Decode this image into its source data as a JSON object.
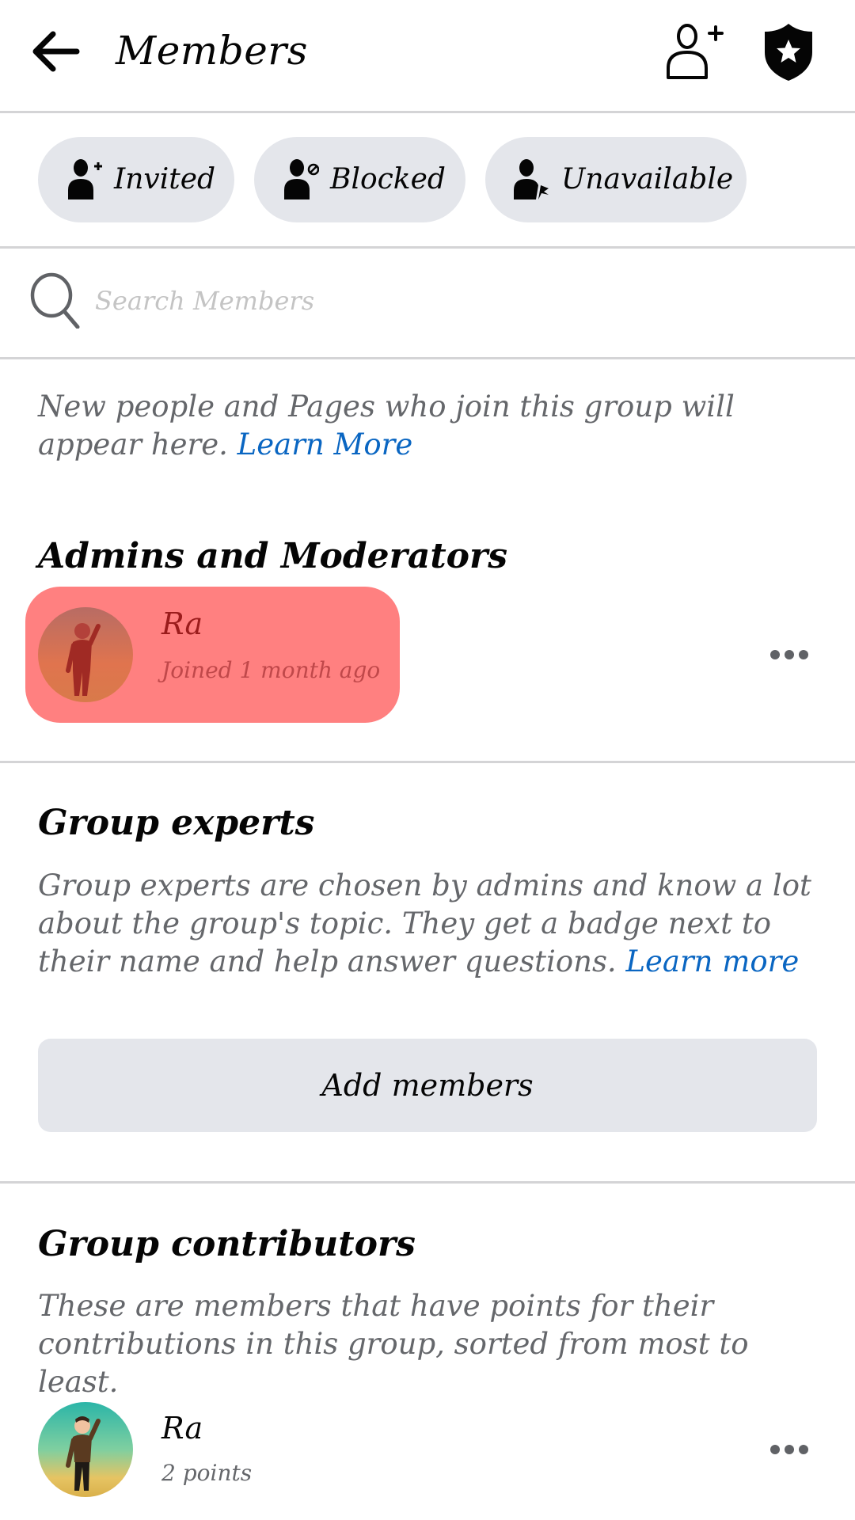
{
  "header": {
    "title": "Members",
    "back_icon": "arrow-left-icon",
    "add_member_icon": "person-add-icon",
    "admin_tools_icon": "shield-star-icon"
  },
  "filter_chips": [
    {
      "label": "Invited",
      "icon": "person-plus-icon"
    },
    {
      "label": "Blocked",
      "icon": "person-blocked-icon"
    },
    {
      "label": "Unavailable",
      "icon": "person-flag-icon"
    }
  ],
  "search": {
    "placeholder": "Search Members",
    "value": "",
    "icon": "search-icon"
  },
  "info": {
    "text": "New people and Pages who join this group will appear here.",
    "link": "Learn More"
  },
  "admins": {
    "title": "Admins and Moderators",
    "members": [
      {
        "name": "Ra",
        "subtitle": "Joined 1 month ago",
        "highlighted": true
      }
    ]
  },
  "experts": {
    "title": "Group experts",
    "text": "Group experts are chosen by admins and know a lot about the group's topic. They get a badge next to their name and help answer questions.",
    "link": "Learn more",
    "button_label": "Add members"
  },
  "contributors": {
    "title": "Group contributors",
    "text": "These are members that have points for their contributions in this group, sorted from most to least.",
    "members": [
      {
        "name": "Ra",
        "subtitle": "2 points"
      }
    ]
  },
  "colors": {
    "chip_bg": "#e4e6eb",
    "link": "#0a66c2",
    "highlight": "#ff8080",
    "secondary_text": "#65676b"
  }
}
